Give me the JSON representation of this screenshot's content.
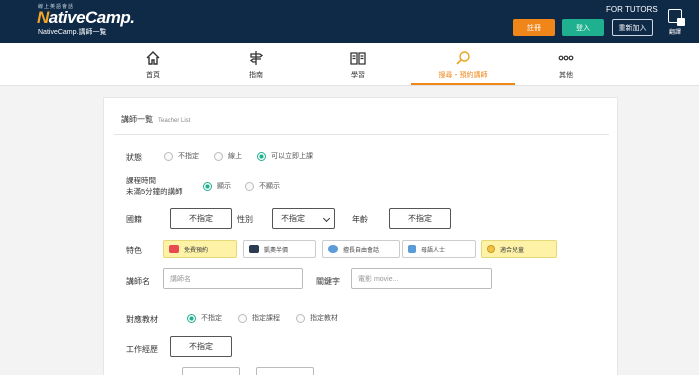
{
  "header": {
    "logo_tagline": "線上英語會話",
    "logo_text_n": "N",
    "logo_text_rest": "ativeCamp.",
    "logo_sub": "NativeCamp.講師一覧",
    "for_tutors": "FOR TUTORS",
    "register_label": "註冊",
    "login_label": "登入",
    "rejoin_label": "重新加入",
    "translate_label": "翻譯"
  },
  "nav": {
    "items": [
      {
        "label": "首頁",
        "icon": "home-icon"
      },
      {
        "label": "指南",
        "icon": "signpost-icon"
      },
      {
        "label": "學習",
        "icon": "book-icon"
      },
      {
        "label": "搜尋・預約講師",
        "icon": "search-icon",
        "active": true
      },
      {
        "label": "其他",
        "icon": "more-icon"
      }
    ]
  },
  "card": {
    "title": "講師一覧",
    "title_en": "Teacher List",
    "status": {
      "label": "狀態",
      "options": [
        "不指定",
        "線上",
        "可以立即上課"
      ],
      "selected": "可以立即上課"
    },
    "short_lessons": {
      "label_line1": "課程時間",
      "label_line2": "未滿5分鐘的講師",
      "options": [
        "顯示",
        "不顯示"
      ],
      "selected": "顯示"
    },
    "nationality": {
      "label": "國籍",
      "value": "不指定"
    },
    "gender": {
      "label": "性別",
      "value": "不指定"
    },
    "age": {
      "label": "年齡",
      "value": "不指定"
    },
    "features": {
      "label": "特色",
      "chips": [
        {
          "label": "免費預約",
          "highlight": true,
          "icon_color": "#e8484f"
        },
        {
          "label": "凱奧半價",
          "highlight": false,
          "icon_color": "#2d3b52"
        },
        {
          "label": "擅長自由會話",
          "highlight": false,
          "icon_color": "#5a9bd8"
        },
        {
          "label": "母語人士",
          "highlight": false,
          "icon_color": "#5a9bd8"
        },
        {
          "label": "適合兒童",
          "highlight": true,
          "icon_color": "#f2c14a"
        }
      ]
    },
    "teacher_name": {
      "label": "講師名",
      "placeholder": "講師名"
    },
    "keyword": {
      "label": "關鍵字",
      "placeholder": "電影 movie..."
    },
    "materials": {
      "label": "對應教材",
      "options": [
        "不指定",
        "指定課程",
        "指定教材"
      ],
      "selected": "不指定"
    },
    "experience": {
      "label": "工作經歷",
      "value": "不指定"
    }
  }
}
